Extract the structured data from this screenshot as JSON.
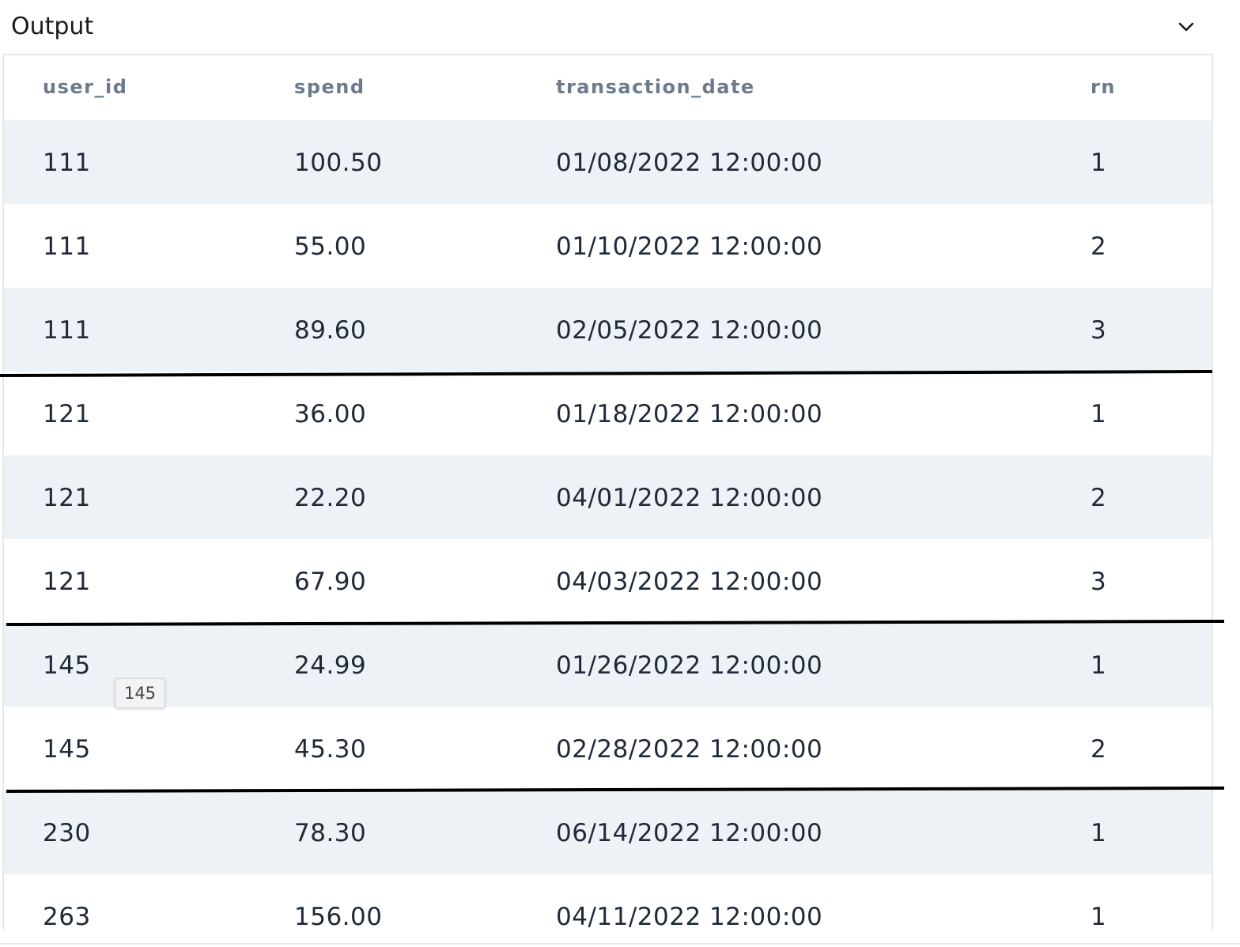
{
  "panel": {
    "title": "Output"
  },
  "table": {
    "columns": [
      "user_id",
      "spend",
      "transaction_date",
      "rn"
    ],
    "rows": [
      [
        "111",
        "100.50",
        "01/08/2022 12:00:00",
        "1"
      ],
      [
        "111",
        "55.00",
        "01/10/2022 12:00:00",
        "2"
      ],
      [
        "111",
        "89.60",
        "02/05/2022 12:00:00",
        "3"
      ],
      [
        "121",
        "36.00",
        "01/18/2022 12:00:00",
        "1"
      ],
      [
        "121",
        "22.20",
        "04/01/2022 12:00:00",
        "2"
      ],
      [
        "121",
        "67.90",
        "04/03/2022 12:00:00",
        "3"
      ],
      [
        "145",
        "24.99",
        "01/26/2022 12:00:00",
        "1"
      ],
      [
        "145",
        "45.30",
        "02/28/2022 12:00:00",
        "2"
      ],
      [
        "230",
        "78.30",
        "06/14/2022 12:00:00",
        "1"
      ],
      [
        "263",
        "156.00",
        "04/11/2022 12:00:00",
        "1"
      ]
    ]
  },
  "tooltip": {
    "text": "145"
  },
  "colors": {
    "header_text": "#6b7a8c",
    "cell_text": "#1f2937",
    "row_stripe": "#edf2f6",
    "border": "#e5e9ee",
    "annotation_line": "#000000"
  },
  "icons": {
    "collapse": "chevron-down-icon"
  }
}
